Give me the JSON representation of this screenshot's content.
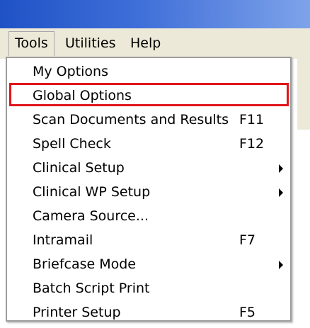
{
  "menubar": {
    "items": [
      "Tools",
      "Utilities",
      "Help"
    ]
  },
  "menu": {
    "items": [
      {
        "label": "My Options",
        "shortcut": "",
        "submenu": false
      },
      {
        "label": "Global Options",
        "shortcut": "",
        "submenu": false
      },
      {
        "label": "Scan Documents and Results",
        "shortcut": "F11",
        "submenu": false
      },
      {
        "label": "Spell Check",
        "shortcut": "F12",
        "submenu": false
      },
      {
        "label": "Clinical Setup",
        "shortcut": "",
        "submenu": true
      },
      {
        "label": "Clinical WP Setup",
        "shortcut": "",
        "submenu": true
      },
      {
        "label": "Camera Source...",
        "shortcut": "",
        "submenu": false
      },
      {
        "label": "Intramail",
        "shortcut": "F7",
        "submenu": false
      },
      {
        "label": "Briefcase Mode",
        "shortcut": "",
        "submenu": true
      },
      {
        "label": "Batch Script Print",
        "shortcut": "",
        "submenu": false
      },
      {
        "label": "Printer Setup",
        "shortcut": "F5",
        "submenu": false
      }
    ],
    "highlighted_item": "Global Options",
    "highlight_color": "#e0151b"
  },
  "colors": {
    "titlebar": "#1f52c6",
    "menubar": "#ece9d8"
  }
}
